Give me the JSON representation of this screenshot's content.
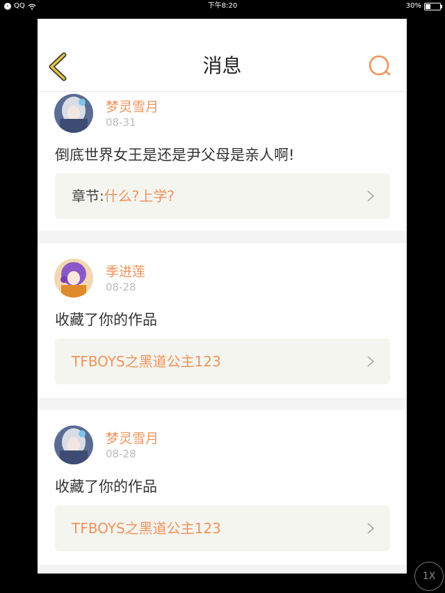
{
  "status_bar": {
    "back_app": "QQ",
    "time": "下午8:20",
    "battery": "30%",
    "battery_level": 0.3
  },
  "header": {
    "title": "消息"
  },
  "messages": [
    {
      "username": "梦灵雪月",
      "date": "08-31",
      "text": "倒底世界女王是还是尹父母是亲人啊!",
      "ref_prefix": "章节:",
      "ref_link": "什么?上学?"
    },
    {
      "username": "季进莲",
      "date": "08-28",
      "text": "收藏了你的作品",
      "ref_prefix": "",
      "ref_link": "TFBOYS之黑道公主123"
    },
    {
      "username": "梦灵雪月",
      "date": "08-28",
      "text": "收藏了你的作品",
      "ref_prefix": "",
      "ref_link": "TFBOYS之黑道公主123"
    }
  ],
  "overlay": {
    "speed_label": "1X"
  },
  "colors": {
    "accent": "#f0935c",
    "back_arrow": "#e2c24a"
  }
}
